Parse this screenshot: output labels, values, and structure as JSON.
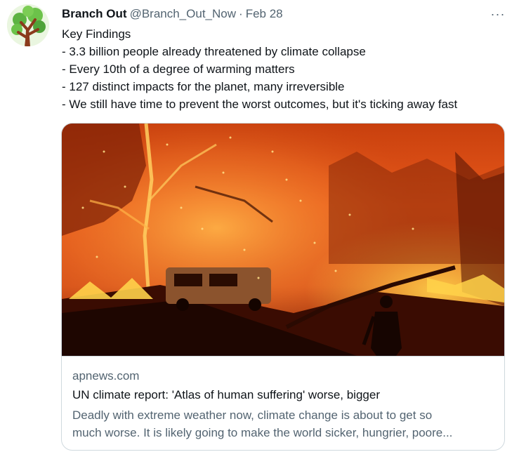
{
  "tweet": {
    "author_name": "Branch Out",
    "handle": "@Branch_Out_Now",
    "separator": "·",
    "date": "Feb 28",
    "more_label": "···",
    "avatar_icon": "tree-icon",
    "lines": [
      "Key Findings",
      "- 3.3 billion people already threatened by climate collapse",
      "- Every 10th of a degree of warming matters",
      "- 127 distinct impacts for the planet, many irreversible",
      "- We still have time to prevent the worst outcomes, but it's ticking away fast"
    ]
  },
  "card": {
    "image_alt": "wildfire-photo",
    "domain": "apnews.com",
    "title": "UN climate report: 'Atlas of human suffering' worse, bigger",
    "description_lines": [
      "Deadly with extreme weather now, climate change is about to get so",
      "much worse. It is likely going to make the world sicker, hungrier, poore..."
    ]
  },
  "colors": {
    "text_primary": "#0f1419",
    "text_secondary": "#536471",
    "border": "#cfd9de",
    "fire_orange": "#e8581a",
    "fire_yellow": "#ffd24a"
  }
}
